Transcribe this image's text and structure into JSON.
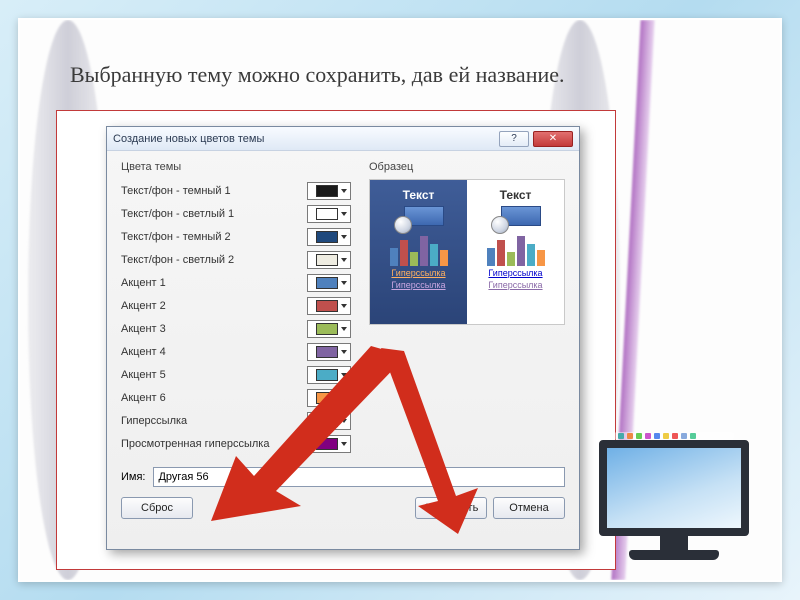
{
  "slide": {
    "caption": "Выбранную тему можно сохранить, дав ей название."
  },
  "dialog": {
    "title": "Создание новых цветов темы",
    "section_colors": "Цвета темы",
    "section_sample": "Образец",
    "rows": [
      {
        "label": "Текст/фон - темный 1",
        "color": "#1a1a1a"
      },
      {
        "label": "Текст/фон - светлый 1",
        "color": "#ffffff"
      },
      {
        "label": "Текст/фон - темный 2",
        "color": "#1f497d"
      },
      {
        "label": "Текст/фон - светлый 2",
        "color": "#eeece1"
      },
      {
        "label": "Акцент 1",
        "color": "#4f81bd"
      },
      {
        "label": "Акцент 2",
        "color": "#c0504d"
      },
      {
        "label": "Акцент 3",
        "color": "#9bbb59"
      },
      {
        "label": "Акцент 4",
        "color": "#8064a2"
      },
      {
        "label": "Акцент 5",
        "color": "#4bacc6"
      },
      {
        "label": "Акцент 6",
        "color": "#f79646"
      },
      {
        "label": "Гиперссылка",
        "color": "#0000ff"
      },
      {
        "label": "Просмотренная гиперссылка",
        "color": "#800080"
      }
    ],
    "preview": {
      "text_label": "Текст",
      "hyperlink": "Гиперссылка",
      "hyperlink_visited": "Гиперссылка",
      "bar_colors": [
        "#4f81bd",
        "#c0504d",
        "#9bbb59",
        "#8064a2",
        "#4bacc6",
        "#f79646"
      ]
    },
    "name_label": "Имя:",
    "name_value": "Другая 56",
    "buttons": {
      "reset": "Сброс",
      "save": "Сохранить",
      "cancel": "Отмена"
    }
  }
}
